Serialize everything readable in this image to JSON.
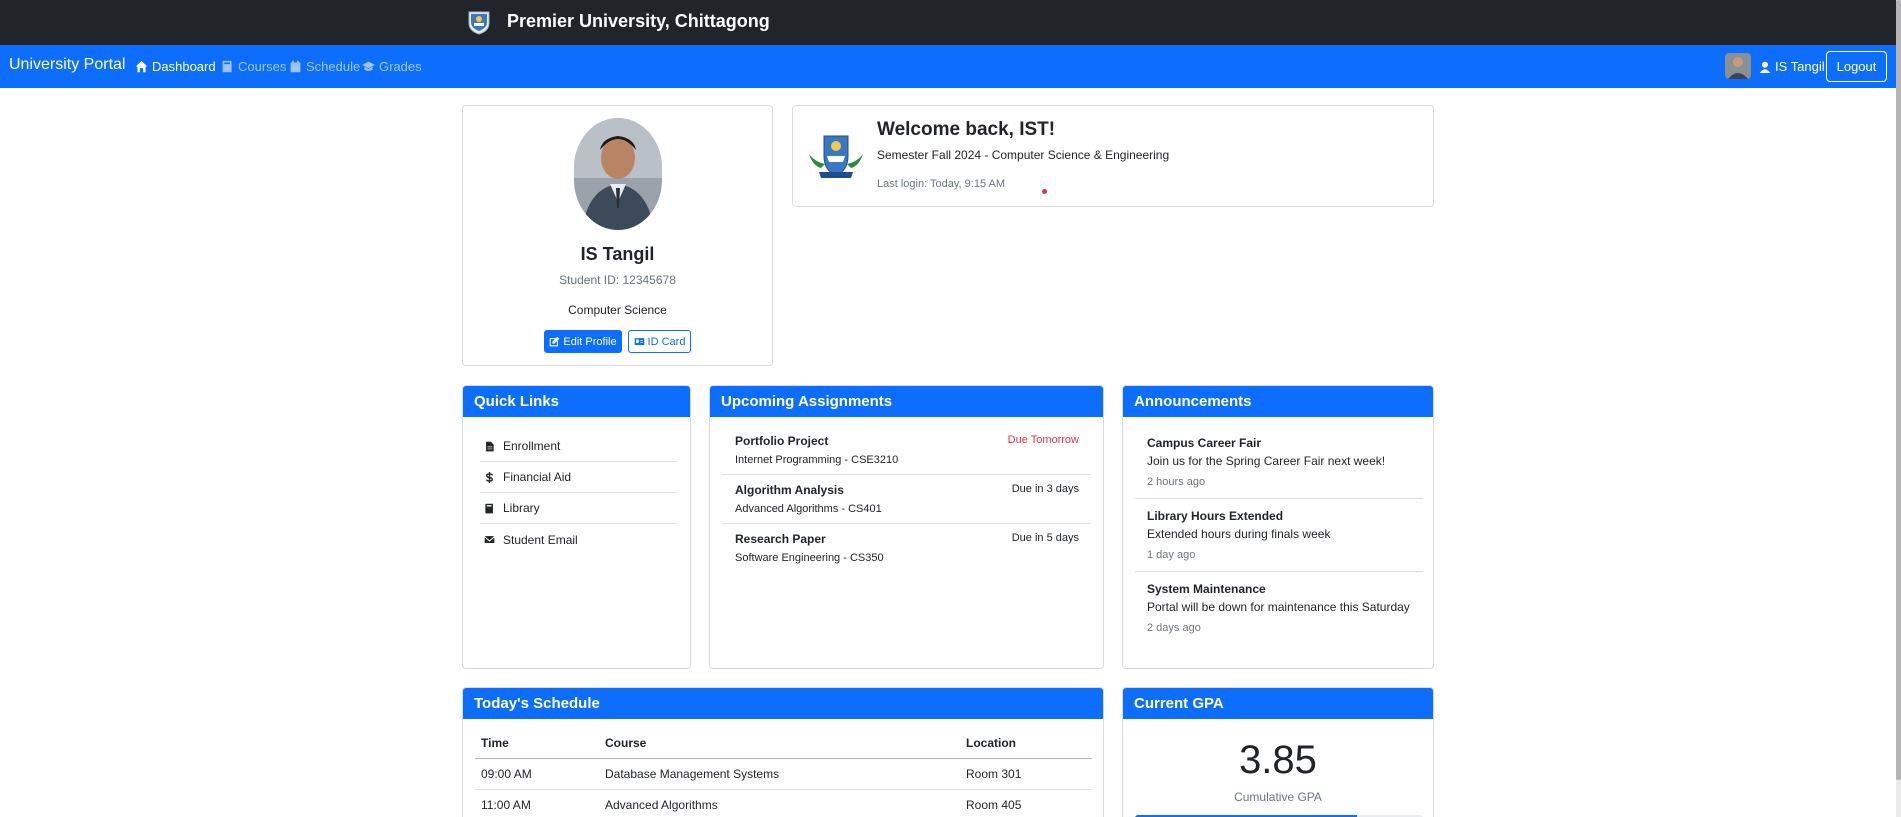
{
  "topbar": {
    "university_name": "Premier University, Chittagong",
    "logo_icon": "university-crest-icon"
  },
  "navbar": {
    "brand": "University Portal",
    "items": [
      {
        "label": "Dashboard",
        "icon": "home-icon",
        "active": true
      },
      {
        "label": "Courses",
        "icon": "book-icon",
        "active": false
      },
      {
        "label": "Schedule",
        "icon": "calendar-icon",
        "active": false
      },
      {
        "label": "Grades",
        "icon": "graduation-cap-icon",
        "active": false
      }
    ],
    "user_name": "IS Tangil",
    "logout_label": "Logout"
  },
  "profile": {
    "name": "IS Tangil",
    "student_id": "Student ID: 12345678",
    "department": "Computer Science",
    "edit_label": "Edit Profile",
    "idcard_label": "ID Card"
  },
  "welcome": {
    "heading": "Welcome back, IST!",
    "semester": "Semester Fall 2024 - Computer Science & Engineering",
    "last_login": "Last login: Today, 9:15 AM"
  },
  "quick_links": {
    "title": "Quick Links",
    "items": [
      {
        "label": "Enrollment",
        "icon": "file-icon"
      },
      {
        "label": "Financial Aid",
        "icon": "dollar-icon"
      },
      {
        "label": "Library",
        "icon": "book-icon"
      },
      {
        "label": "Student Email",
        "icon": "envelope-icon"
      }
    ]
  },
  "assignments": {
    "title": "Upcoming Assignments",
    "items": [
      {
        "title": "Portfolio Project",
        "course": "Internet Programming - CSE3210",
        "due": "Due Tomorrow",
        "urgent": true
      },
      {
        "title": "Algorithm Analysis",
        "course": "Advanced Algorithms - CS401",
        "due": "Due in 3 days",
        "urgent": false
      },
      {
        "title": "Research Paper",
        "course": "Software Engineering - CS350",
        "due": "Due in 5 days",
        "urgent": false
      }
    ]
  },
  "announcements": {
    "title": "Announcements",
    "items": [
      {
        "title": "Campus Career Fair",
        "body": "Join us for the Spring Career Fair next week!",
        "time": "2 hours ago"
      },
      {
        "title": "Library Hours Extended",
        "body": "Extended hours during finals week",
        "time": "1 day ago"
      },
      {
        "title": "System Maintenance",
        "body": "Portal will be down for maintenance this Saturday",
        "time": "2 days ago"
      }
    ]
  },
  "schedule": {
    "title": "Today's Schedule",
    "headers": [
      "Time",
      "Course",
      "Location"
    ],
    "rows": [
      [
        "09:00 AM",
        "Database Management Systems",
        "Room 301"
      ],
      [
        "11:00 AM",
        "Advanced Algorithms",
        "Room 405"
      ]
    ]
  },
  "gpa": {
    "title": "Current GPA",
    "value": "3.85",
    "label": "Cumulative GPA",
    "progress_fraction": 0.77
  },
  "colors": {
    "primary": "#0d6efd",
    "dark": "#212529",
    "danger": "#dc3545"
  }
}
